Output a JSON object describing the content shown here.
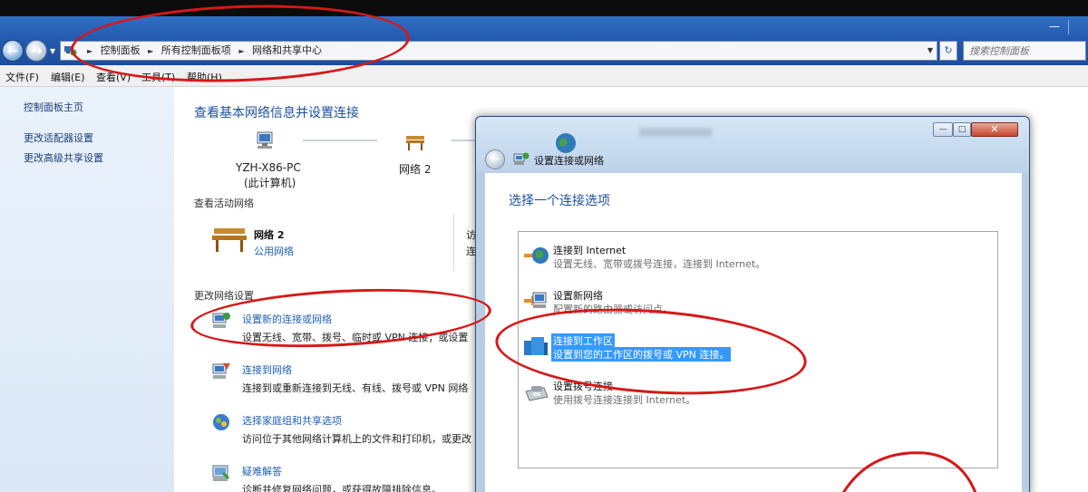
{
  "window": {
    "minimize_glyph": "—",
    "breadcrumbs": [
      "控制面板",
      "所有控制面板项",
      "网络和共享中心"
    ],
    "search_placeholder": "搜索控制面板"
  },
  "menu": [
    "文件(F)",
    "编辑(E)",
    "查看(V)",
    "工具(T)",
    "帮助(H)"
  ],
  "left_pane": {
    "home": "控制面板主页",
    "adapter": "更改适配器设置",
    "sharing": "更改高级共享设置"
  },
  "main": {
    "title": "查看基本网络信息并设置连接",
    "computer_name": "YZH-X86-PC",
    "computer_sub": "(此计算机)",
    "network_map_name": "网络 2",
    "active_heading": "查看活动网络",
    "active_network_name": "网络 2",
    "active_network_type": "公用网络",
    "access_label_fragment": "访",
    "connect_label_fragment": "连",
    "change_heading": "更改网络设置",
    "tasks": [
      {
        "title": "设置新的连接或网络",
        "desc": "设置无线、宽带、拨号、临时或 VPN 连接；或设置"
      },
      {
        "title": "连接到网络",
        "desc": "连接到或重新连接到无线、有线、拨号或 VPN 网络"
      },
      {
        "title": "选择家庭组和共享选项",
        "desc": "访问位于其他网络计算机上的文件和打印机，或更改"
      },
      {
        "title": "疑难解答",
        "desc": "诊断并修复网络问题，或获得故障排除信息。"
      }
    ]
  },
  "dialog": {
    "caption": "设置连接或网络",
    "close_glyph": "✕",
    "heading": "选择一个连接选项",
    "options": [
      {
        "title": "连接到 Internet",
        "desc": "设置无线、宽带或拨号连接，连接到 Internet。"
      },
      {
        "title": "设置新网络",
        "desc": "配置新的路由器或访问点。"
      },
      {
        "title": "连接到工作区",
        "desc": "设置到您的工作区的拨号或 VPN 连接。"
      },
      {
        "title": "设置拨号连接",
        "desc": "使用拨号连接连接到 Internet。"
      }
    ],
    "selected_index": 2
  },
  "colors": {
    "annotation": "#d71818",
    "selection": "#3399ff",
    "link": "#1f5fb5"
  }
}
